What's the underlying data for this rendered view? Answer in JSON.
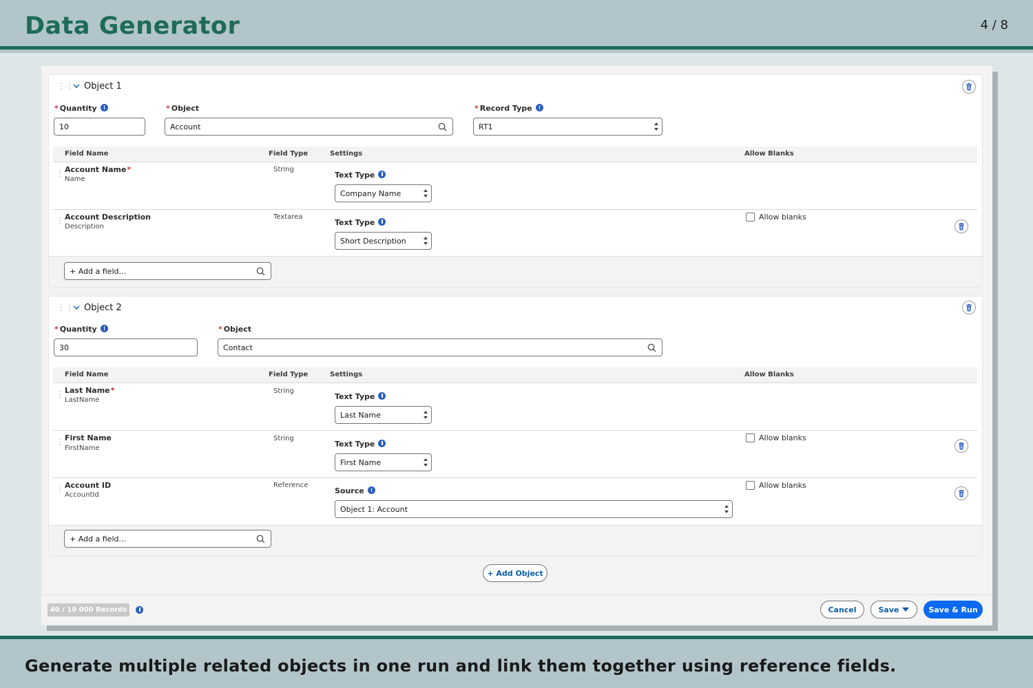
{
  "slide": {
    "title": "Data Generator",
    "page": "4 / 8",
    "caption": "Generate multiple related objects in one run and link them together using reference fields."
  },
  "colors": {
    "accent": "#1e6b59",
    "brand": "#0b6af0",
    "info": "#2b5fbf"
  },
  "icons": [
    "drag-handle-icon",
    "chevron-down-icon",
    "delete-icon",
    "info-icon",
    "search-icon",
    "select-arrows-icon"
  ],
  "objects": [
    {
      "title": "Object 1",
      "quantity_label": "Quantity",
      "quantity_value": "10",
      "object_label": "Object",
      "object_value": "Account",
      "record_type_label": "Record Type",
      "record_type_value": "RT1",
      "columns": [
        "Field Name",
        "Field Type",
        "Settings",
        "Allow Blanks"
      ],
      "rows": [
        {
          "name": "Account Name",
          "required": "*",
          "api": "Name",
          "type": "String",
          "setting_label": "Text Type",
          "setting_value": "Company Name"
        },
        {
          "name": "Account Description",
          "api": "Description",
          "type": "Textarea",
          "setting_label": "Text Type",
          "setting_value": "Short Description",
          "allow_blanks": "Allow blanks"
        }
      ],
      "add_field_placeholder": "+ Add a field..."
    },
    {
      "title": "Object 2",
      "quantity_label": "Quantity",
      "quantity_value": "30",
      "object_label": "Object",
      "object_value": "Contact",
      "columns": [
        "Field Name",
        "Field Type",
        "Settings",
        "Allow Blanks"
      ],
      "rows": [
        {
          "name": "Last Name",
          "required": "*",
          "api": "LastName",
          "type": "String",
          "setting_label": "Text Type",
          "setting_value": "Last Name"
        },
        {
          "name": "First Name",
          "api": "FirstName",
          "type": "String",
          "setting_label": "Text Type",
          "setting_value": "First Name",
          "allow_blanks": "Allow blanks"
        },
        {
          "name": "Account ID",
          "api": "AccountId",
          "type": "Reference",
          "setting_label": "Source",
          "setting_value": "Object 1: Account",
          "allow_blanks": "Allow blanks"
        }
      ],
      "add_field_placeholder": "+ Add a field..."
    }
  ],
  "add_object_label": "+ Add Object",
  "footer": {
    "records": "40 / 10 000 Records",
    "cancel": "Cancel",
    "save": "Save",
    "save_run": "Save & Run"
  }
}
